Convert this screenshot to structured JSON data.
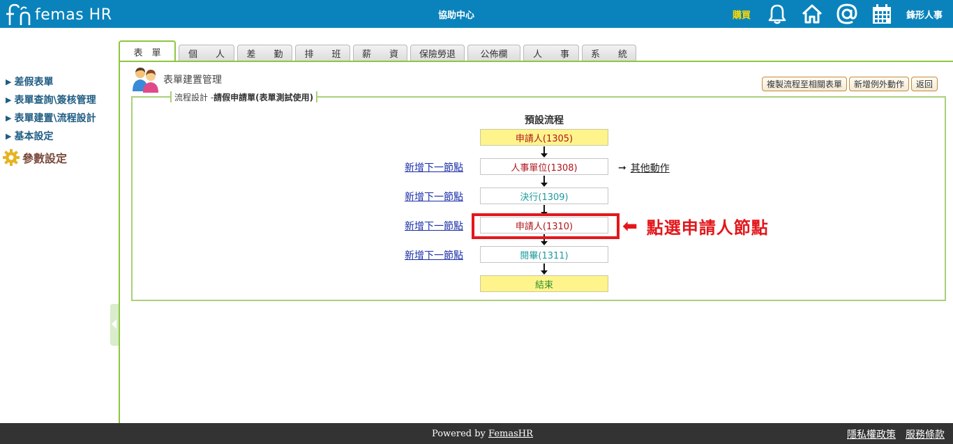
{
  "header": {
    "logo_text": "femas HR",
    "help_center": "協助中心",
    "buy": "購買",
    "icons": [
      "bell-icon",
      "home-icon",
      "at-icon",
      "calendar-icon"
    ],
    "company": "鋒形人事",
    "bg_color": "#0a83bc"
  },
  "tabs": [
    {
      "label": "表　單",
      "active": true
    },
    {
      "label": "個　　人",
      "active": false
    },
    {
      "label": "差　　勤",
      "active": false
    },
    {
      "label": "排　　班",
      "active": false
    },
    {
      "label": "薪　　資",
      "active": false
    },
    {
      "label": "保險勞退",
      "active": false
    },
    {
      "label": "公佈欄",
      "active": false
    },
    {
      "label": "人　　事",
      "active": false
    },
    {
      "label": "系　　統",
      "active": false
    }
  ],
  "sidebar": {
    "items": [
      {
        "label": "差假表單"
      },
      {
        "label": "表單查詢\\簽核管理"
      },
      {
        "label": "表單建置\\流程設計"
      },
      {
        "label": "基本設定"
      }
    ],
    "settings_label": "參數設定"
  },
  "page": {
    "title": "表單建置管理",
    "buttons": {
      "copy_flow": "複製流程至相關表單",
      "add_exception": "新增例外動作",
      "back": "返回"
    },
    "legend_prefix": "流程設計 - ",
    "legend_form": "請假申請單(表單測試使用)"
  },
  "flow": {
    "title": "預設流程",
    "nodes": [
      {
        "label": "申請人(1305)"
      },
      {
        "label": "人事單位(1308)"
      },
      {
        "label": "決行(1309)"
      },
      {
        "label": "申請人(1310)"
      },
      {
        "label": "閱畢(1311)"
      },
      {
        "label": "結束"
      }
    ],
    "add_next_label": "新增下一節點",
    "other_action": "其他動作",
    "callout": "點選申請人節點",
    "callout_color": "#e3171b"
  },
  "footer": {
    "powered_prefix": "Powered by ",
    "powered_brand": "FemasHR",
    "privacy": "隱私權政策",
    "terms": "服務條款"
  }
}
